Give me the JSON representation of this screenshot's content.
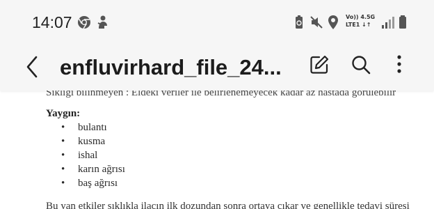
{
  "status_bar": {
    "time": "14:07",
    "network_text_top": "Vo)) 4.5G",
    "network_text_bottom": "LTE1 ↓↑",
    "icons": [
      "chrome-icon",
      "character-icon",
      "battery-saver-icon",
      "mute-icon",
      "location-icon",
      "signal-icon",
      "battery-icon"
    ]
  },
  "toolbar": {
    "title": "enfluvirhard_file_24...",
    "icons": [
      "back-arrow-icon",
      "edit-icon",
      "search-icon",
      "more-vertical-icon"
    ]
  },
  "document": {
    "cut_top_line": "Sıklığı bilinmeyen      : Eldeki veriler ile belirlenemeyecek kadar az hastada görülebilir",
    "section_heading": "Yaygın:",
    "list_items": [
      "bulantı",
      "kusma",
      "ishal",
      "karın ağrısı",
      "baş ağrısı"
    ],
    "bullet_char": "•",
    "cut_bottom_line": "Bu yan etkiler sıklıkla ilacın ilk dozundan sonra ortaya çıkar ve genellikle tedavi süresi"
  }
}
